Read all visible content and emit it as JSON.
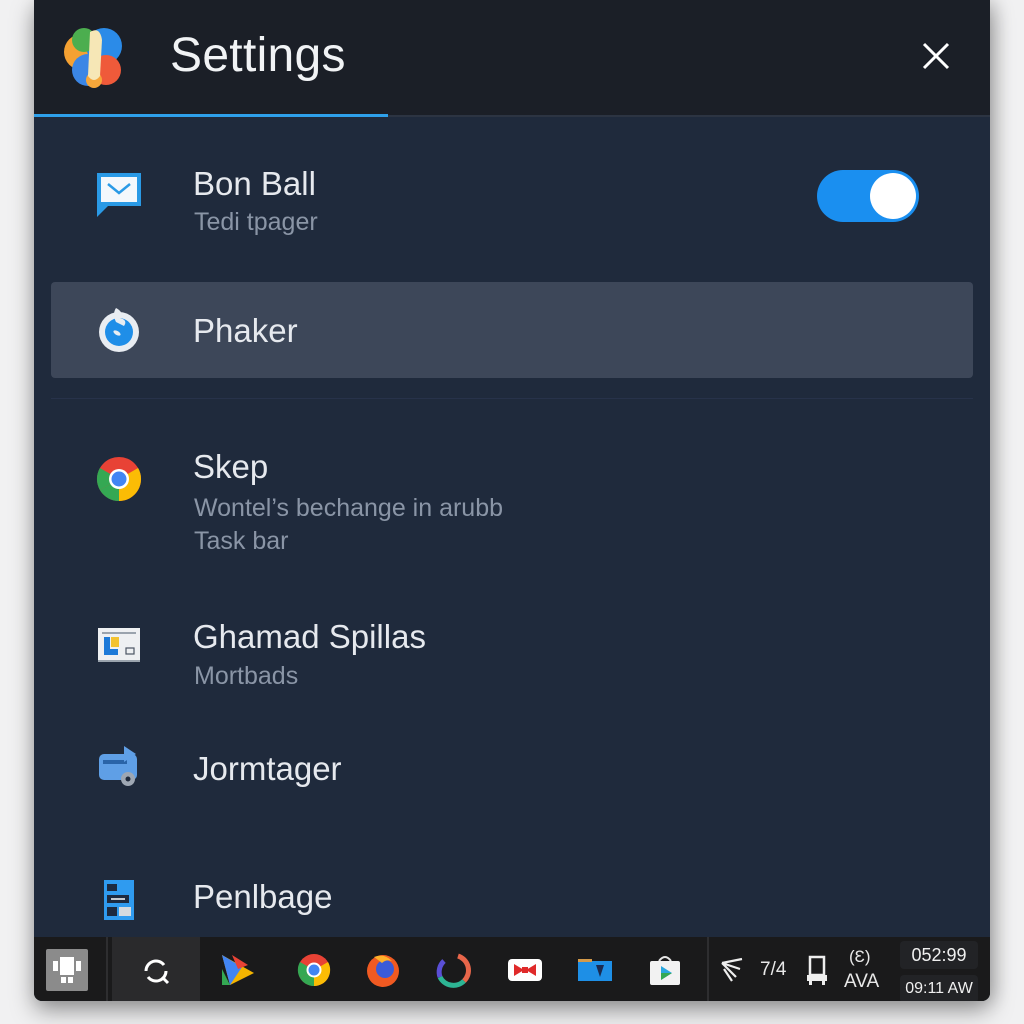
{
  "window": {
    "title": "Settings",
    "close_icon": "close-icon",
    "logo_icon": "app-logo-icon"
  },
  "items": [
    {
      "label": "Bon Ball",
      "sub": "Tedi tpager",
      "icon": "message-icon",
      "toggle": {
        "on": true
      }
    },
    {
      "label": "Phaker",
      "icon": "flame-icon",
      "selected": true
    },
    {
      "label": "Skep",
      "sub": "Wontel’s bechange in arubb",
      "sub2": "Task bar",
      "icon": "chrome-icon"
    },
    {
      "label": "Ghamad Spillas",
      "sub": "Mortbads",
      "icon": "presentation-icon"
    },
    {
      "label": "Jormtager",
      "icon": "transfer-drive-icon"
    },
    {
      "label": "Penlbage",
      "icon": "document-grid-icon"
    }
  ],
  "colors": {
    "accent": "#2ea0ea",
    "toggle_on": "#1a8ff0",
    "panel_bg": "#1f2a3c",
    "titlebar_bg": "#1b1f27",
    "selected_bg": "#3d4759"
  },
  "taskbar": {
    "apps": [
      {
        "name": "start-icon"
      },
      {
        "name": "search-refresh-icon"
      },
      {
        "name": "play-triangle-icon"
      },
      {
        "name": "chrome-icon"
      },
      {
        "name": "firefox-icon"
      },
      {
        "name": "ring-app-icon"
      },
      {
        "name": "bowtie-app-icon"
      },
      {
        "name": "folder-icon"
      },
      {
        "name": "play-store-icon"
      }
    ],
    "tray": {
      "network_icon": "network-icon",
      "battery_text": "7/4",
      "device_icon": "device-icon",
      "lang_icon_text": "(Ɛ)",
      "lang_text": "AVA",
      "time_top": "052:99",
      "time_bottom": "09:11 AW"
    }
  }
}
